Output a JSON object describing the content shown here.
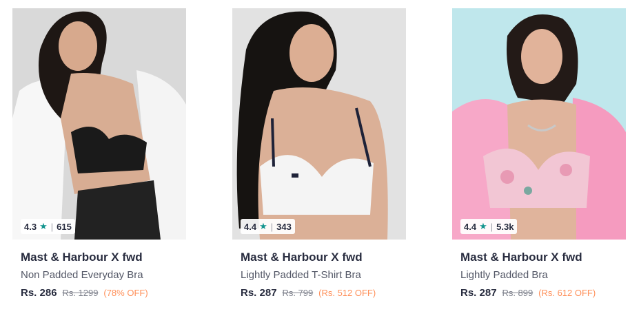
{
  "products": [
    {
      "rating": "4.3",
      "rating_count": "615",
      "brand": "Mast & Harbour X fwd",
      "name": "Non Padded Everyday Bra",
      "price": "Rs. 286",
      "mrp": "Rs. 1299",
      "discount": "(78% OFF)",
      "image_bg": "#d9d9d9",
      "garment_color": "#1a1a1a",
      "shirt_color": "#f7f7f7"
    },
    {
      "rating": "4.4",
      "rating_count": "343",
      "brand": "Mast & Harbour X fwd",
      "name": "Lightly Padded T-Shirt Bra",
      "price": "Rs. 287",
      "mrp": "Rs. 799",
      "discount": "(Rs. 512 OFF)",
      "image_bg": "#e2e2e2",
      "garment_color": "#f4f4f4",
      "shirt_color": "none"
    },
    {
      "rating": "4.4",
      "rating_count": "5.3k",
      "brand": "Mast & Harbour X fwd",
      "name": "Lightly Padded Bra",
      "price": "Rs. 287",
      "mrp": "Rs. 899",
      "discount": "(Rs. 612 OFF)",
      "image_bg": "#bfe7ec",
      "garment_color": "#f2c6d4",
      "shirt_color": "#f7a8c8"
    }
  ],
  "rating_star_icon": "star-icon",
  "colors": {
    "star": "#14958f",
    "discount": "#ff905a",
    "brand_text": "#282c3f"
  }
}
